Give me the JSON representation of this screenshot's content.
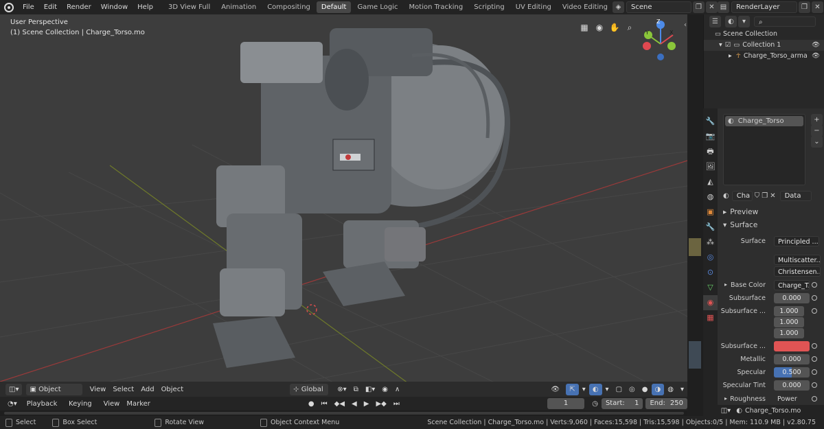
{
  "menu": {
    "items": [
      "File",
      "Edit",
      "Render",
      "Window",
      "Help"
    ]
  },
  "workspaces": {
    "tabs": [
      "3D View Full",
      "Animation",
      "Compositing",
      "Default",
      "Game Logic",
      "Motion Tracking",
      "Scripting",
      "UV Editing",
      "Video Editing"
    ],
    "active": "Default"
  },
  "scene": {
    "name": "Scene",
    "view_layer": "RenderLayer"
  },
  "viewport": {
    "perspective": "User Perspective",
    "collection_info": "(1) Scene Collection | Charge_Torso.mo",
    "gizmo_axes": {
      "x": "X",
      "y": "Y",
      "z": "Z"
    },
    "mode": "Object Mode",
    "menus": [
      "View",
      "Select",
      "Add",
      "Object"
    ],
    "transform_orientation": "Global"
  },
  "timeline": {
    "menus": [
      "Playback",
      "Keying",
      "View",
      "Marker"
    ],
    "current_frame": "1",
    "start_label": "Start:",
    "start": "1",
    "end_label": "End:",
    "end": "250"
  },
  "outliner": {
    "rows": [
      {
        "label": "Scene Collection",
        "level": 0
      },
      {
        "label": "Collection 1",
        "level": 1
      },
      {
        "label": "Charge_Torso_arma",
        "level": 2
      }
    ]
  },
  "properties": {
    "material_slot": "Charge_Torso",
    "material_name": "Cha",
    "data_dropdown": "Data",
    "panels": {
      "preview": "Preview",
      "surface": "Surface"
    },
    "fields": {
      "surface_label": "Surface",
      "surface_value": "Principled ...",
      "distribution": "Multiscatter...",
      "subsurface_method": "Christensen...",
      "base_color_label": "Base Color",
      "base_color_value": "Charge_T...",
      "subsurface_label": "Subsurface",
      "subsurface_value": "0.000",
      "subsurface_radius_label": "Subsurface ...",
      "subsurface_radius": [
        "1.000",
        "1.000",
        "1.000"
      ],
      "subsurface_color_label": "Subsurface ...",
      "subsurface_color": "#e05454",
      "metallic_label": "Metallic",
      "metallic_value": "0.000",
      "specular_label": "Specular",
      "specular_value": "0.500",
      "specular_fill": 0.5,
      "specular_tint_label": "Specular Tint",
      "specular_tint_value": "0.000",
      "roughness_label": "Roughness",
      "roughness_value": "Power"
    },
    "footer_file": "Charge_Torso.mo"
  },
  "statusbar": {
    "select": "Select",
    "box_select": "Box Select",
    "rotate_view": "Rotate View",
    "context_menu": "Object Context Menu",
    "stats": "Scene Collection | Charge_Torso.mo | Verts:9,060 | Faces:15,598 | Tris:15,598 | Objects:0/5 | Mem: 110.9 MB | v2.80.75"
  },
  "colors": {
    "accent_blue": "#4772b3",
    "axis_x": "#e04850",
    "axis_y": "#8ac63a",
    "axis_z": "#4d8be8"
  }
}
